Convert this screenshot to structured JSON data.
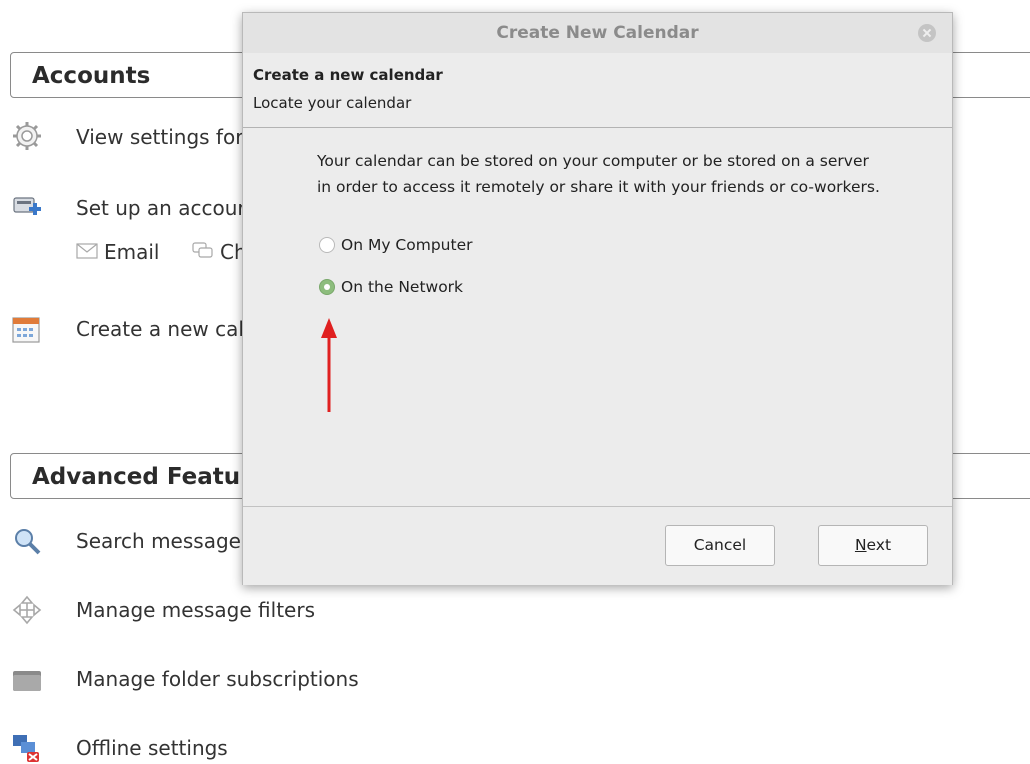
{
  "background": {
    "accounts_header": "Accounts",
    "rows": [
      {
        "label": "View settings for",
        "icon": "gear-icon"
      },
      {
        "label": "Set up an accour",
        "icon": "account-add-icon"
      },
      {
        "label": "Create a new cal",
        "icon": "calendar-icon"
      }
    ],
    "sub_items": [
      {
        "label": "Email",
        "icon": "envelope-icon"
      },
      {
        "label": "Ch",
        "icon": "chat-icon"
      }
    ],
    "advanced_header": "Advanced Featu",
    "advanced_rows": [
      {
        "label": "Search messages",
        "icon": "magnifier-icon"
      },
      {
        "label": "Manage message filters",
        "icon": "filter-icon"
      },
      {
        "label": "Manage folder subscriptions",
        "icon": "folder-icon"
      },
      {
        "label": "Offline settings",
        "icon": "offline-icon"
      }
    ]
  },
  "dialog": {
    "title": "Create New Calendar",
    "heading": "Create a new calendar",
    "subheading": "Locate your calendar",
    "description": "Your calendar can be stored on your computer or be stored on a server in order to access it remotely or share it with your friends or co-workers.",
    "options": [
      {
        "label": "On My Computer",
        "selected": false
      },
      {
        "label": "On the Network",
        "selected": true
      }
    ],
    "buttons": {
      "cancel": "Cancel",
      "next_mnemonic": "N",
      "next_rest": "ext"
    },
    "accent_color": "#8dbd7d",
    "annotation_arrow_color": "#e02020"
  }
}
